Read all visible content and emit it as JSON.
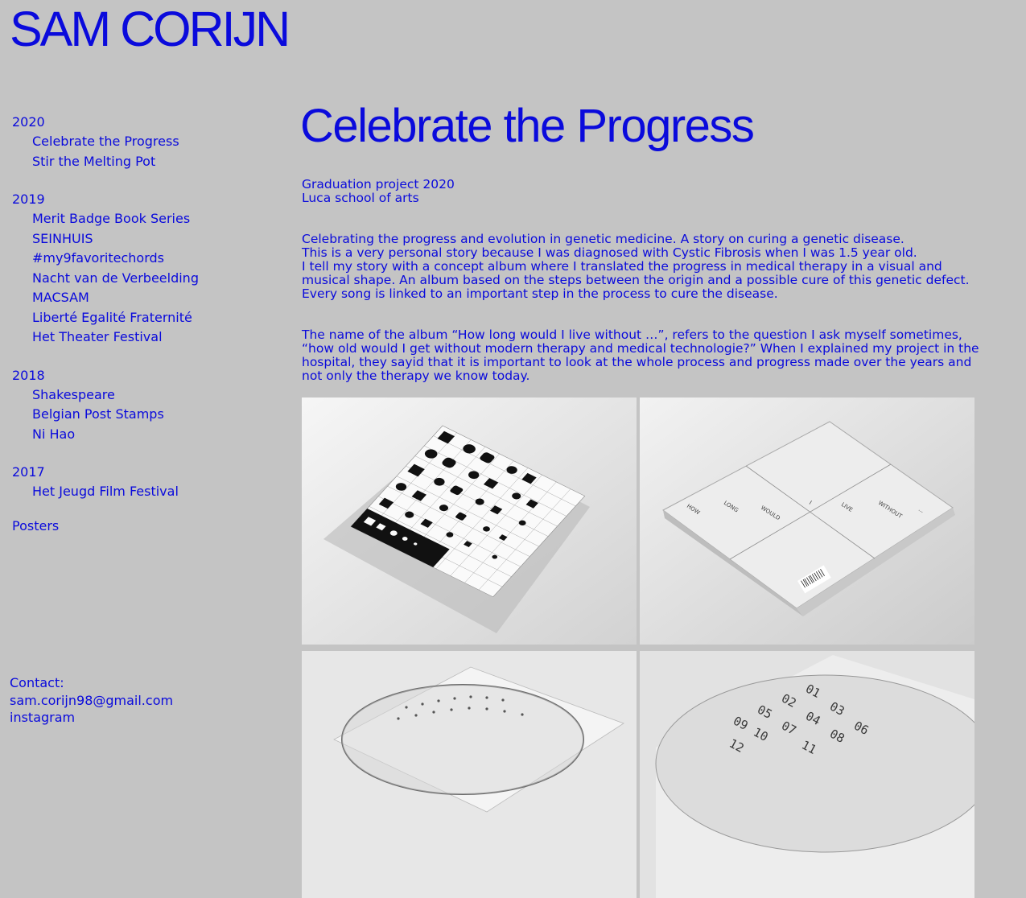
{
  "site": {
    "name": "SAM CORIJN"
  },
  "nav": {
    "groups": [
      {
        "year": "2020",
        "items": [
          "Celebrate the Progress",
          "Stir the Melting Pot"
        ]
      },
      {
        "year": "2019",
        "items": [
          "Merit Badge Book Series",
          "SEINHUIS",
          "#my9favoritechords",
          "Nacht van de Verbeelding",
          "MACSAM",
          "Liberté Egalité Fraternité",
          "Het Theater Festival"
        ]
      },
      {
        "year": "2018",
        "items": [
          "Shakespeare",
          "Belgian Post Stamps",
          "Ni Hao"
        ]
      },
      {
        "year": "2017",
        "items": [
          "Het Jeugd Film Festival"
        ]
      }
    ],
    "posters": "Posters"
  },
  "contact": {
    "label": "Contact:",
    "email": "sam.corijn98@gmail.com",
    "instagram": "instagram"
  },
  "project": {
    "title": "Celebrate the Progress",
    "subtitle_lines": [
      "Graduation project 2020",
      "Luca school of arts"
    ],
    "paragraph1": [
      "Celebrating the progress and evolution in genetic medicine. A story on curing a genetic disease.",
      "This is a very personal story because I was diagnosed with Cystic Fibrosis when I was 1.5 year old.",
      "I tell my story with a concept album where I translated the progress in medical therapy in a visual and musical shape. An album based on the steps between the origin and a possible cure of this genetic defect. Every song is linked to an important step in the process to cure the disease."
    ],
    "paragraph2": "The name of the album “How long would I live without …”, refers to the question I ask myself sometimes, “how old would I get without modern therapy and medical technologie?” When I explained my project in the hospital, they sayid that it is important to look at the whole process and progress made over the years and not only the therapy we know today.",
    "images": {
      "back_cover_words": [
        "HOW",
        "LONG",
        "WOULD",
        "I",
        "LIVE",
        "WITHOUT",
        "..."
      ],
      "disc_numbers": [
        "01",
        "02",
        "03",
        "04",
        "05",
        "06",
        "07",
        "08",
        "09",
        "10",
        "11",
        "12"
      ]
    }
  },
  "colors": {
    "background": "#c4c4c4",
    "accent": "#0a0adc"
  }
}
